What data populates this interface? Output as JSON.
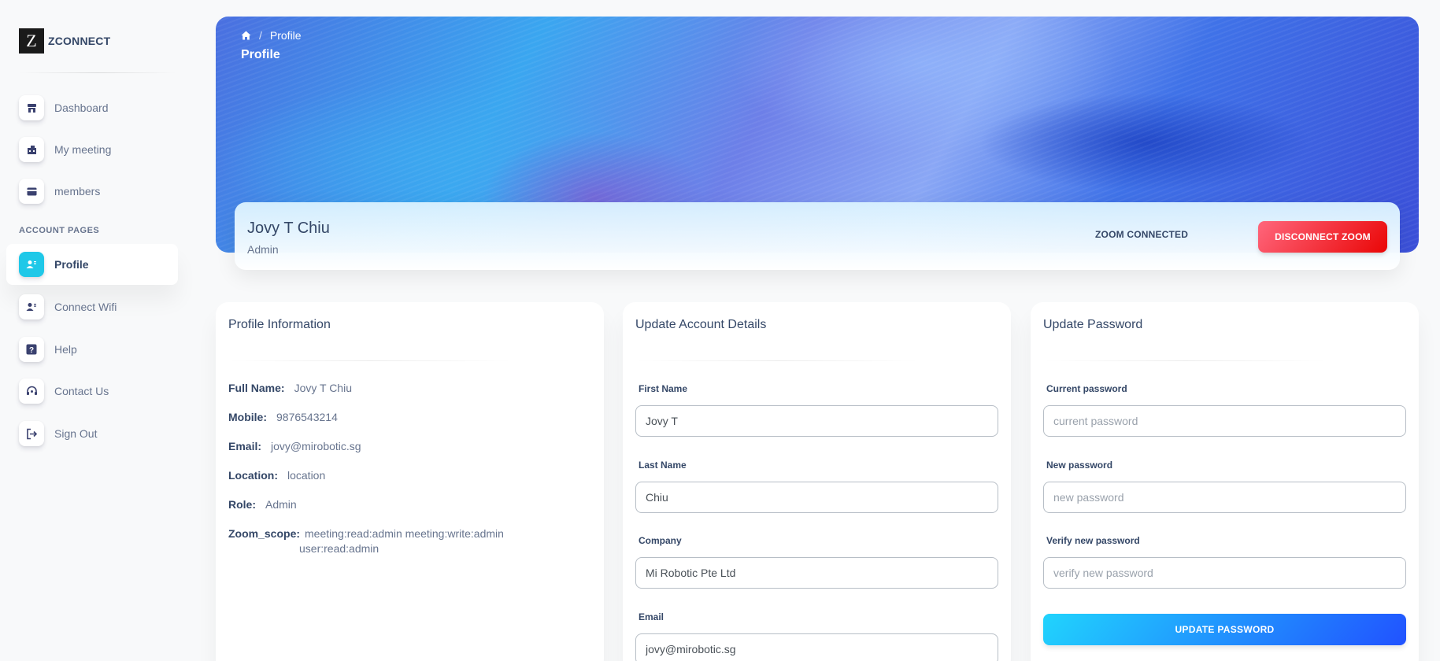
{
  "brand": {
    "logo_letter": "Z",
    "name": "ZCONNECT"
  },
  "sidebar": {
    "section_title": "ACCOUNT PAGES",
    "items": [
      {
        "label": "Dashboard",
        "icon": "shop-icon"
      },
      {
        "label": "My meeting",
        "icon": "office-icon"
      },
      {
        "label": "members",
        "icon": "credit-card-icon"
      },
      {
        "label": "Profile",
        "icon": "user-plus-icon",
        "active": true
      },
      {
        "label": "Connect Wifi",
        "icon": "user-plus-icon"
      },
      {
        "label": "Help",
        "icon": "question-icon"
      },
      {
        "label": "Contact Us",
        "icon": "headset-icon"
      },
      {
        "label": "Sign Out",
        "icon": "sign-out-icon"
      }
    ]
  },
  "header": {
    "breadcrumb": {
      "home_icon": "home-icon",
      "separator": "/",
      "current": "Profile"
    },
    "title": "Profile"
  },
  "profile": {
    "name": "Jovy T Chiu",
    "role": "Admin",
    "zoom_status": "ZOOM CONNECTED",
    "disconnect_label": "DISCONNECT ZOOM"
  },
  "profile_info": {
    "title": "Profile Information",
    "rows": [
      {
        "label": "Full Name:",
        "value": "Jovy T Chiu"
      },
      {
        "label": "Mobile:",
        "value": "9876543214"
      },
      {
        "label": "Email:",
        "value": "jovy@mirobotic.sg"
      },
      {
        "label": "Location:",
        "value": "location"
      },
      {
        "label": "Role:",
        "value": "Admin"
      },
      {
        "label": "Zoom_scope:",
        "value": "meeting:read:admin meeting:write:admin",
        "value_line2": "user:read:admin"
      }
    ]
  },
  "account_details": {
    "title": "Update Account Details",
    "fields": [
      {
        "label": "First Name",
        "value": "Jovy T"
      },
      {
        "label": "Last Name",
        "value": "Chiu"
      },
      {
        "label": "Company",
        "value": "Mi Robotic Pte Ltd"
      },
      {
        "label": "Email",
        "value": "jovy@mirobotic.sg"
      }
    ]
  },
  "password": {
    "title": "Update Password",
    "fields": [
      {
        "label": "Current password",
        "placeholder": "current password"
      },
      {
        "label": "New password",
        "placeholder": "new password"
      },
      {
        "label": "Verify new password",
        "placeholder": "verify new password"
      }
    ],
    "submit_label": "UPDATE PASSWORD"
  },
  "colors": {
    "accent": "#21d4fd",
    "accent_dark": "#2152ff",
    "danger": "#ea0606",
    "text_primary": "#344767",
    "text_secondary": "#67748e"
  }
}
